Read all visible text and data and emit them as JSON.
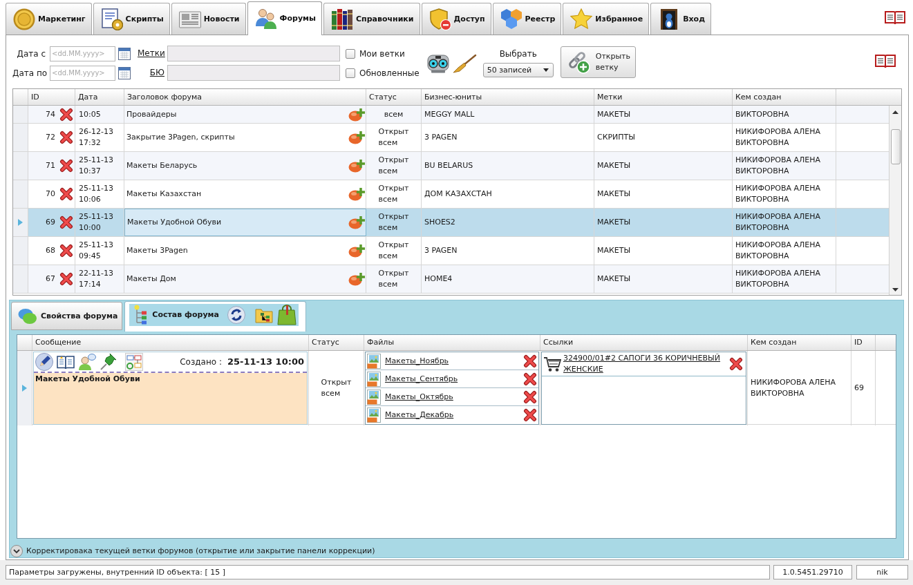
{
  "nav_tabs": [
    {
      "label": "Маркетинг",
      "selected": false
    },
    {
      "label": "Скрипты",
      "selected": false
    },
    {
      "label": "Новости",
      "selected": false
    },
    {
      "label": "Форумы",
      "selected": true
    },
    {
      "label": "Справочники",
      "selected": false
    },
    {
      "label": "Доступ",
      "selected": false
    },
    {
      "label": "Реестр",
      "selected": false
    },
    {
      "label": "Избранное",
      "selected": false
    },
    {
      "label": "Вход",
      "selected": false
    }
  ],
  "filters": {
    "date_from": {
      "label": "Дата с",
      "placeholder": "<dd.MM.yyyy>"
    },
    "date_to": {
      "label": "Дата по",
      "placeholder": "<dd.MM.yyyy>"
    },
    "tags": {
      "label": "Метки"
    },
    "business_units": {
      "label": "БЮ"
    },
    "checkboxes": [
      {
        "label": "Мои ветки",
        "checked": false
      },
      {
        "label": "Обновленные",
        "checked": false
      }
    ],
    "records": {
      "label": "Выбрать",
      "value": "50 записей"
    },
    "open_button": {
      "label": "Открыть ветку"
    }
  },
  "forums_table": {
    "columns": [
      "ID",
      "Дата",
      "Заголовок форума",
      "Статус",
      "Бизнес-юниты",
      "Метки",
      "Кем создан"
    ],
    "rows": [
      {
        "id": "74",
        "date": "10:05",
        "title": "Провайдеры",
        "status": "всем",
        "business_units": "MEGGY MALL",
        "tags": "МАКЕТЫ",
        "created_by": "ВИКТОРОВНА",
        "selected": false
      },
      {
        "id": "72",
        "date": "26-12-13 17:32",
        "title": "Закрытие 3Pagen, скрипты",
        "status": "Открыт всем",
        "business_units": "3 PAGEN",
        "tags": "СКРИПТЫ",
        "created_by": "НИКИФОРОВА АЛЕНА ВИКТОРОВНА",
        "selected": false
      },
      {
        "id": "71",
        "date": "25-11-13 10:37",
        "title": "Макеты Беларусь",
        "status": "Открыт всем",
        "business_units": "BU BELARUS",
        "tags": "МАКЕТЫ",
        "created_by": "НИКИФОРОВА АЛЕНА ВИКТОРОВНА",
        "selected": false
      },
      {
        "id": "70",
        "date": "25-11-13 10:06",
        "title": "Макеты Казахстан",
        "status": "Открыт всем",
        "business_units": "ДОМ КАЗАХСТАН",
        "tags": "МАКЕТЫ",
        "created_by": "НИКИФОРОВА АЛЕНА ВИКТОРОВНА",
        "selected": false
      },
      {
        "id": "69",
        "date": "25-11-13 10:00",
        "title": "Макеты Удобной Обуви",
        "status": "Открыт всем",
        "business_units": "SHOES2",
        "tags": "МАКЕТЫ",
        "created_by": "НИКИФОРОВА АЛЕНА ВИКТОРОВНА",
        "selected": true
      },
      {
        "id": "68",
        "date": "25-11-13 09:45",
        "title": "Макеты 3Pagen",
        "status": "Открыт всем",
        "business_units": "3 PAGEN",
        "tags": "МАКЕТЫ",
        "created_by": "НИКИФОРОВА АЛЕНА ВИКТОРОВНА",
        "selected": false
      },
      {
        "id": "67",
        "date": "22-11-13 17:14",
        "title": "Макеты Дом",
        "status": "Открыт всем",
        "business_units": "HOME4",
        "tags": "МАКЕТЫ",
        "created_by": "НИКИФОРОВА АЛЕНА ВИКТОРОВНА",
        "selected": false
      }
    ]
  },
  "detail_panel": {
    "tabs": [
      {
        "label": "Свойства форума",
        "selected": false
      },
      {
        "label": "Состав форума",
        "selected": true
      }
    ],
    "table": {
      "columns": [
        "Сообщение",
        "Статус",
        "Файлы",
        "Ссылки",
        "Кем создан",
        "ID"
      ],
      "rows": [
        {
          "selected": true,
          "created_label": "Создано :",
          "created_at": "25-11-13 10:00",
          "message": "Макеты Удобной Обуви",
          "status": "Открыт всем",
          "files": [
            "Макеты_Ноябрь",
            "Макеты_Сентябрь",
            "Макеты_Октябрь",
            "Макеты_Декабрь"
          ],
          "links": [
            "324900/01#2 САПОГИ 36 КОРИЧНЕВЫЙ ЖЕНСКИЕ"
          ],
          "created_by": "НИКИФОРОВА АЛЕНА ВИКТОРОВНА",
          "id": "69"
        }
      ]
    },
    "correction_toggle": {
      "label": "Корректировака текущей ветки форумов (открытие или закрытие панели коррекции)",
      "expanded": false
    }
  },
  "status_bar": {
    "message": "Параметры загружены, внутренний ID объекта: [ 15 ]",
    "version": "1.0.5451.29710",
    "user": "nik"
  }
}
